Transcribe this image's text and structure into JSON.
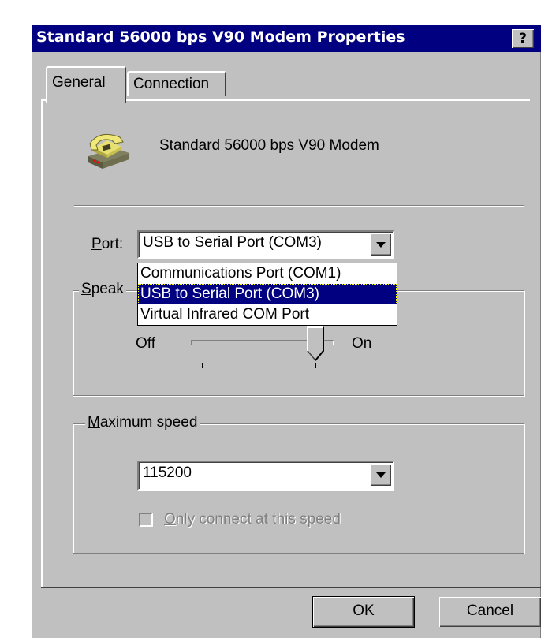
{
  "window": {
    "title": "Standard 56000 bps V90 Modem Properties",
    "help_label": "?"
  },
  "tabs": [
    {
      "label": "General"
    },
    {
      "label": "Connection"
    }
  ],
  "general": {
    "modem_name": "Standard 56000 bps V90 Modem",
    "port": {
      "label_accel": "P",
      "label_rest": "ort:",
      "selected": "USB to Serial Port (COM3)",
      "options": [
        "Communications Port (COM1)",
        "USB to Serial Port (COM3)",
        "Virtual Infrared COM Port"
      ],
      "highlighted_option": "USB to Serial Port (COM3)"
    },
    "speaker": {
      "label_accel": "S",
      "label_rest": "peak",
      "off_label": "Off",
      "on_label": "On",
      "level_fraction": 1.0
    },
    "max_speed": {
      "label_accel": "M",
      "label_rest": "aximum speed",
      "selected": "115200",
      "only_connect_accel": "O",
      "only_connect_rest": "nly connect at this speed",
      "only_connect_checked": false,
      "only_connect_enabled": false
    }
  },
  "buttons": {
    "ok": "OK",
    "cancel": "Cancel"
  },
  "colors": {
    "title_bar": "#000080",
    "face": "#c0c0c0",
    "selection": "#000080"
  },
  "icons": {
    "modem": "modem-phone-icon",
    "combo_arrow": "chevron-down-icon"
  }
}
